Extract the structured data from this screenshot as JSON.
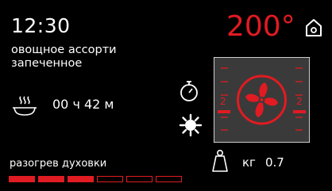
{
  "screen": {
    "clock": "12:30",
    "dish_line1": "овощное ассорти",
    "dish_line2": "запеченное",
    "temperature": "200°",
    "cook_time": "00 ч 42 м",
    "fan_level_left": "2",
    "fan_level_right": "2",
    "weight_unit": "кг",
    "weight_value": "0.7",
    "status": "разогрев духовки",
    "progress_filled_segments": 3,
    "progress_total_segments": 6
  },
  "icons": {
    "home": "home-icon",
    "steam_dish": "steam-dish-icon",
    "timer": "stopwatch-icon",
    "light": "light-icon",
    "fan": "fan-icon",
    "weight": "weight-icon"
  },
  "colors": {
    "accent": "#e11b22",
    "background": "#000000",
    "panel": "#3a3a3a",
    "text": "#ffffff"
  }
}
